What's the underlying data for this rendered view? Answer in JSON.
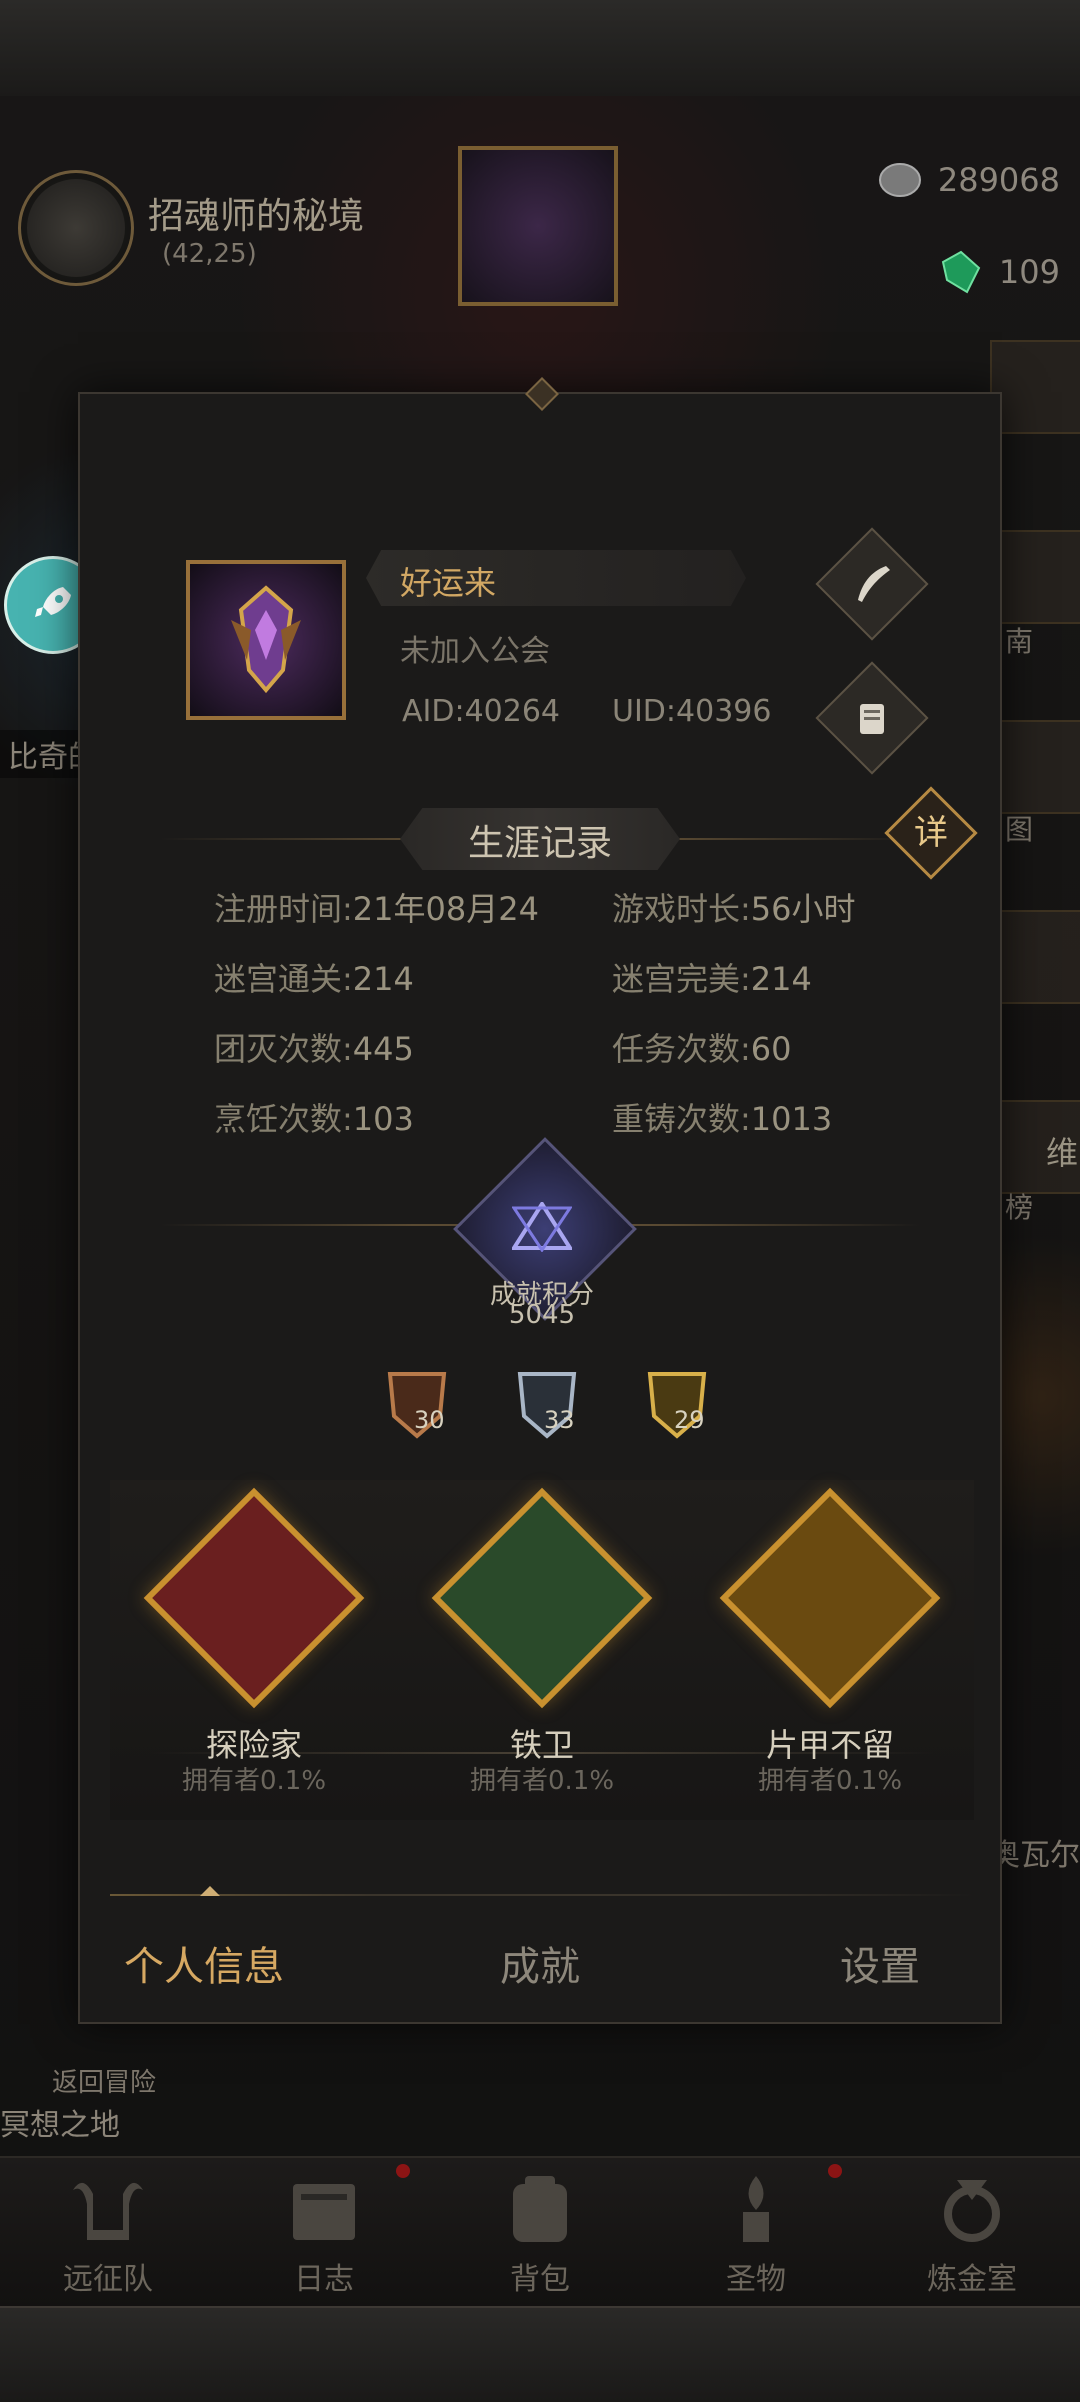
{
  "background": {
    "location": {
      "name": "招魂师的秘境",
      "coord": "(42,25)"
    },
    "resources": [
      {
        "icon": "silver-coin-icon",
        "value": "289068"
      },
      {
        "icon": "green-gem-icon",
        "value": "109"
      }
    ],
    "side_texts": {
      "left_label": "比奇的...",
      "right_top": "南",
      "right_mid": "图",
      "right_low": "榜",
      "right_far": "维"
    },
    "return_label": "返回冒险",
    "meditate_label": "冥想之地",
    "right_faded": "奥瓦尔"
  },
  "bottom_nav": [
    {
      "label": "远征队",
      "icon": "helmet-icon",
      "dot": false
    },
    {
      "label": "日志",
      "icon": "journal-icon",
      "dot": true
    },
    {
      "label": "背包",
      "icon": "backpack-icon",
      "dot": false
    },
    {
      "label": "圣物",
      "icon": "relic-icon",
      "dot": true
    },
    {
      "label": "炼金室",
      "icon": "alchemy-icon",
      "dot": false
    }
  ],
  "profile": {
    "name": "好运来",
    "guild": "未加入公会",
    "aid": "AID:40264",
    "uid": "UID:40396"
  },
  "career": {
    "title": "生涯记录",
    "detail_label": "详",
    "stats": [
      {
        "label": "注册时间:",
        "value": "21年08月24"
      },
      {
        "label": "游戏时长:",
        "value": "56小时"
      },
      {
        "label": "迷宫通关:",
        "value": "214"
      },
      {
        "label": "迷宫完美:",
        "value": "214"
      },
      {
        "label": "团灭次数:",
        "value": "445"
      },
      {
        "label": "任务次数:",
        "value": "60"
      },
      {
        "label": "烹饪次数:",
        "value": "103"
      },
      {
        "label": "重铸次数:",
        "value": "1013"
      }
    ]
  },
  "achievement_score": {
    "label": "成就积分",
    "value": "5045"
  },
  "medals": [
    {
      "tier": "bronze",
      "count": "30",
      "color": "#b87a4a"
    },
    {
      "tier": "silver",
      "count": "33",
      "color": "#a9b6c6"
    },
    {
      "tier": "gold",
      "count": "29",
      "color": "#d8b04a"
    }
  ],
  "achievements": [
    {
      "title": "探险家",
      "owners": "拥有者0.1%",
      "icon": "treasure-map-icon"
    },
    {
      "title": "铁卫",
      "owners": "拥有者0.1%",
      "icon": "armored-warrior-icon"
    },
    {
      "title": "片甲不留",
      "owners": "拥有者0.1%",
      "icon": "maze-icon"
    }
  ],
  "tabs": [
    {
      "label": "个人信息",
      "active": true
    },
    {
      "label": "成就",
      "active": false
    },
    {
      "label": "设置",
      "active": false
    }
  ]
}
